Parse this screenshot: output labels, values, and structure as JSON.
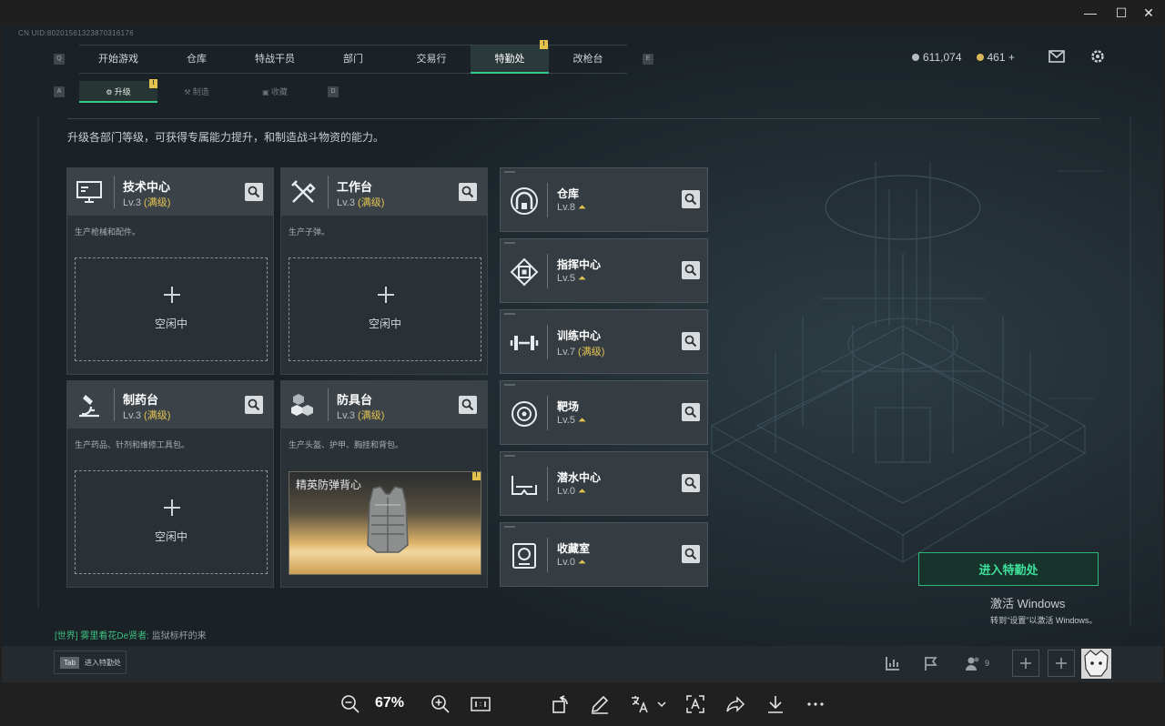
{
  "window": {
    "minimize": "—",
    "maximize": "☐",
    "close": "✕"
  },
  "game": {
    "uid": "CN UID:80201561323870316176",
    "key_left": "Q",
    "key_right": "E",
    "tabs": [
      {
        "label": "开始游戏"
      },
      {
        "label": "仓库"
      },
      {
        "label": "特战干员"
      },
      {
        "label": "部门"
      },
      {
        "label": "交易行"
      },
      {
        "label": "特勤处",
        "active": true,
        "badge": "!"
      },
      {
        "label": "改枪台"
      }
    ],
    "currency": {
      "silver": "611,074",
      "gold": "461 +",
      "silver_color": "#b8bcbe",
      "gold_color": "#d9b85a"
    },
    "subtab_key_left": "A",
    "subtab_key_right": "D",
    "subtabs": [
      {
        "label": "升级",
        "active": true,
        "badge": "!"
      },
      {
        "label": "制造"
      },
      {
        "label": "收藏"
      }
    ],
    "description": "升级各部门等级，可获得专属能力提升，和制造战斗物资的能力。",
    "workbenches": [
      {
        "name": "技术中心",
        "level": "Lv.3",
        "max": "(满级)",
        "text": "生产枪械和配件。",
        "slot": "空闲中",
        "icon": "computer-icon"
      },
      {
        "name": "工作台",
        "level": "Lv.3",
        "max": "(满级)",
        "text": "生产子弹。",
        "slot": "空闲中",
        "icon": "tools-icon"
      },
      {
        "name": "制药台",
        "level": "Lv.3",
        "max": "(满级)",
        "text": "生产药品、针剂和维修工具包。",
        "slot": "空闲中",
        "icon": "microscope-icon"
      },
      {
        "name": "防具台",
        "level": "Lv.3",
        "max": "(满级)",
        "text": "生产头盔、护甲、胸挂和背包。",
        "item": "精英防弹背心",
        "item_badge": "!",
        "icon": "armor-blocks-icon"
      }
    ],
    "facilities": [
      {
        "name": "仓库",
        "level": "Lv.8",
        "icon": "warehouse-icon"
      },
      {
        "name": "指挥中心",
        "level": "Lv.5",
        "icon": "chip-icon"
      },
      {
        "name": "训练中心",
        "level": "Lv.7",
        "max": "(满级)",
        "icon": "dumbbell-icon"
      },
      {
        "name": "靶场",
        "level": "Lv.5",
        "icon": "target-icon"
      },
      {
        "name": "潜水中心",
        "level": "Lv.0",
        "icon": "diving-mask-icon"
      },
      {
        "name": "收藏室",
        "level": "Lv.0",
        "icon": "trophy-icon"
      }
    ],
    "enter_button": "进入特勤处",
    "activation": {
      "line1": "激活 Windows",
      "line2": "转到\"设置\"以激活 Windows。"
    },
    "chat": {
      "channel": "[世界]",
      "user": "雾里看花De贤者:",
      "message": "监狱标杆的来"
    },
    "bottom": {
      "tab_key": "Tab",
      "tab_label": "进入特勤处",
      "friends_count": "9"
    },
    "accent": "#36c98a",
    "level_max_color": "#e3c352"
  },
  "toolbar": {
    "zoom": "67%"
  }
}
